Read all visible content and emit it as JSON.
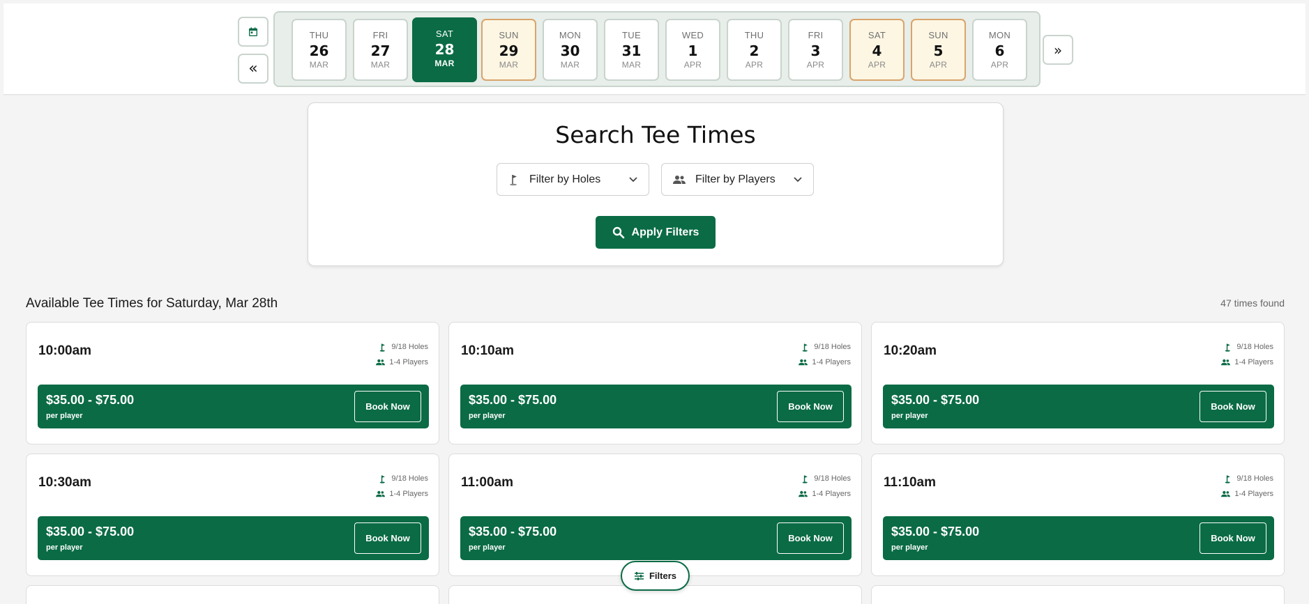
{
  "date_nav": {
    "prev_label": "«",
    "next_label": "»",
    "days": [
      {
        "dow": "THU",
        "num": "26",
        "mon": "MAR",
        "state": "normal"
      },
      {
        "dow": "FRI",
        "num": "27",
        "mon": "MAR",
        "state": "normal"
      },
      {
        "dow": "SAT",
        "num": "28",
        "mon": "MAR",
        "state": "selected"
      },
      {
        "dow": "SUN",
        "num": "29",
        "mon": "MAR",
        "state": "weekend"
      },
      {
        "dow": "MON",
        "num": "30",
        "mon": "MAR",
        "state": "normal"
      },
      {
        "dow": "TUE",
        "num": "31",
        "mon": "MAR",
        "state": "normal"
      },
      {
        "dow": "WED",
        "num": "1",
        "mon": "APR",
        "state": "normal"
      },
      {
        "dow": "THU",
        "num": "2",
        "mon": "APR",
        "state": "normal"
      },
      {
        "dow": "FRI",
        "num": "3",
        "mon": "APR",
        "state": "normal"
      },
      {
        "dow": "SAT",
        "num": "4",
        "mon": "APR",
        "state": "weekend"
      },
      {
        "dow": "SUN",
        "num": "5",
        "mon": "APR",
        "state": "weekend"
      },
      {
        "dow": "MON",
        "num": "6",
        "mon": "APR",
        "state": "normal"
      }
    ]
  },
  "search": {
    "title": "Search Tee Times",
    "holes_filter": "Filter by Holes",
    "players_filter": "Filter by Players",
    "apply_label": "Apply Filters"
  },
  "results": {
    "title": "Available Tee Times for Saturday, Mar 28th",
    "count": "47 times found",
    "times": [
      {
        "time": "10:00am",
        "holes": "9/18 Holes",
        "players": "1-4 Players",
        "price": "$35.00 - $75.00",
        "per": "per player",
        "book": "Book Now"
      },
      {
        "time": "10:10am",
        "holes": "9/18 Holes",
        "players": "1-4 Players",
        "price": "$35.00 - $75.00",
        "per": "per player",
        "book": "Book Now"
      },
      {
        "time": "10:20am",
        "holes": "9/18 Holes",
        "players": "1-4 Players",
        "price": "$35.00 - $75.00",
        "per": "per player",
        "book": "Book Now"
      },
      {
        "time": "10:30am",
        "holes": "9/18 Holes",
        "players": "1-4 Players",
        "price": "$35.00 - $75.00",
        "per": "per player",
        "book": "Book Now"
      },
      {
        "time": "11:00am",
        "holes": "9/18 Holes",
        "players": "1-4 Players",
        "price": "$35.00 - $75.00",
        "per": "per player",
        "book": "Book Now"
      },
      {
        "time": "11:10am",
        "holes": "9/18 Holes",
        "players": "1-4 Players",
        "price": "$35.00 - $75.00",
        "per": "per player",
        "book": "Book Now"
      }
    ]
  },
  "filters_fab": {
    "label": "Filters"
  },
  "colors": {
    "primary": "#0a6b45",
    "weekend_bg": "#fdf6e3",
    "weekend_border": "#d9a46b"
  },
  "icons": {
    "calendar": "calendar-icon",
    "golf_flag": "golf-flag-icon",
    "players": "players-icon",
    "search": "search-icon",
    "filters": "sliders-icon"
  }
}
